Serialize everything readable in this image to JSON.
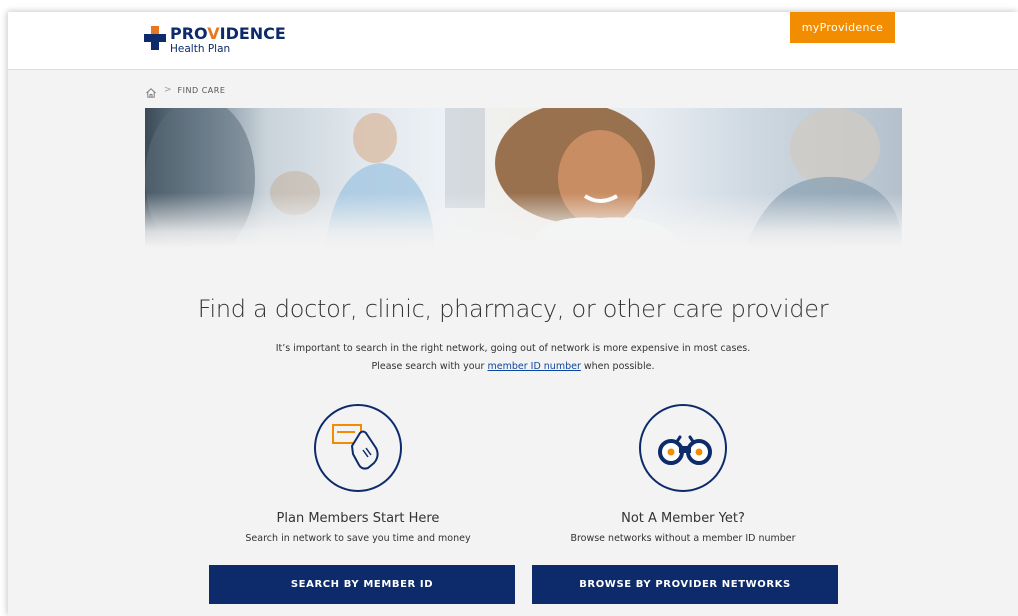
{
  "header": {
    "logo_word_part1": "PRO",
    "logo_word_part2": "V",
    "logo_word_part3": "IDENCE",
    "logo_sub": "Health Plan",
    "my_button": "myProvidence"
  },
  "breadcrumb": {
    "home_icon": "home-icon",
    "separator": ">",
    "current": "FIND CARE"
  },
  "main": {
    "title": "Find a doctor, clinic, pharmacy, or other care provider",
    "sub1": "It’s important to search in the right network, going out of network is more expensive in most cases.",
    "sub2_before": "Please search with your ",
    "sub2_link": "member ID number",
    "sub2_after": " when possible."
  },
  "cards": [
    {
      "icon": "member-card-icon",
      "title": "Plan Members Start Here",
      "desc": "Search in network to save you time and money",
      "button": "SEARCH BY MEMBER ID"
    },
    {
      "icon": "binoculars-icon",
      "title": "Not A Member Yet?",
      "desc": "Browse networks without a member ID number",
      "button": "BROWSE BY PROVIDER NETWORKS"
    }
  ],
  "colors": {
    "brand_navy": "#0d2b6b",
    "brand_orange": "#e87722",
    "button_orange": "#f28c00",
    "link_blue": "#0d47a1",
    "page_bg": "#f3f3f3"
  }
}
